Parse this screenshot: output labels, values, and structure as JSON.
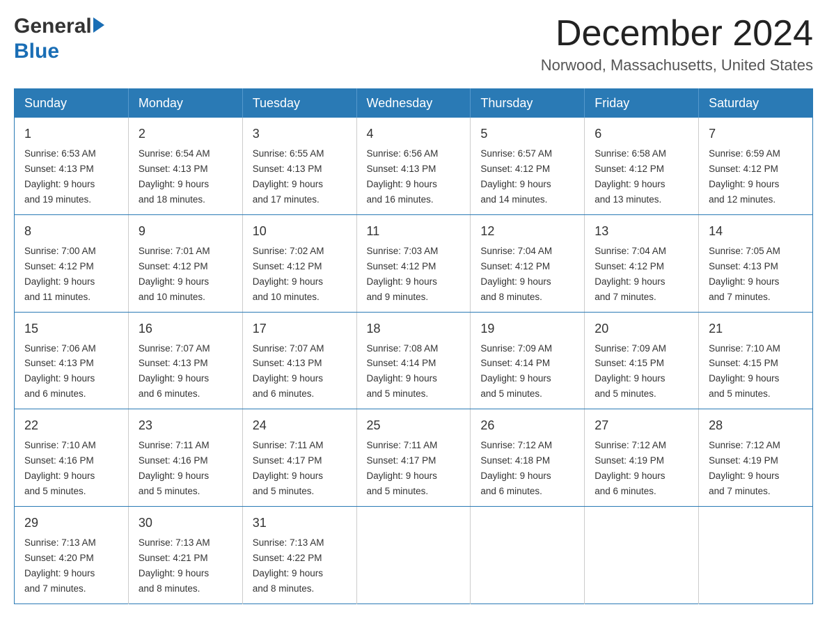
{
  "header": {
    "logo_general": "General",
    "logo_blue": "Blue",
    "month_title": "December 2024",
    "location": "Norwood, Massachusetts, United States"
  },
  "days_of_week": [
    "Sunday",
    "Monday",
    "Tuesday",
    "Wednesday",
    "Thursday",
    "Friday",
    "Saturday"
  ],
  "weeks": [
    [
      {
        "day": "1",
        "sunrise": "6:53 AM",
        "sunset": "4:13 PM",
        "daylight": "9 hours and 19 minutes."
      },
      {
        "day": "2",
        "sunrise": "6:54 AM",
        "sunset": "4:13 PM",
        "daylight": "9 hours and 18 minutes."
      },
      {
        "day": "3",
        "sunrise": "6:55 AM",
        "sunset": "4:13 PM",
        "daylight": "9 hours and 17 minutes."
      },
      {
        "day": "4",
        "sunrise": "6:56 AM",
        "sunset": "4:13 PM",
        "daylight": "9 hours and 16 minutes."
      },
      {
        "day": "5",
        "sunrise": "6:57 AM",
        "sunset": "4:12 PM",
        "daylight": "9 hours and 14 minutes."
      },
      {
        "day": "6",
        "sunrise": "6:58 AM",
        "sunset": "4:12 PM",
        "daylight": "9 hours and 13 minutes."
      },
      {
        "day": "7",
        "sunrise": "6:59 AM",
        "sunset": "4:12 PM",
        "daylight": "9 hours and 12 minutes."
      }
    ],
    [
      {
        "day": "8",
        "sunrise": "7:00 AM",
        "sunset": "4:12 PM",
        "daylight": "9 hours and 11 minutes."
      },
      {
        "day": "9",
        "sunrise": "7:01 AM",
        "sunset": "4:12 PM",
        "daylight": "9 hours and 10 minutes."
      },
      {
        "day": "10",
        "sunrise": "7:02 AM",
        "sunset": "4:12 PM",
        "daylight": "9 hours and 10 minutes."
      },
      {
        "day": "11",
        "sunrise": "7:03 AM",
        "sunset": "4:12 PM",
        "daylight": "9 hours and 9 minutes."
      },
      {
        "day": "12",
        "sunrise": "7:04 AM",
        "sunset": "4:12 PM",
        "daylight": "9 hours and 8 minutes."
      },
      {
        "day": "13",
        "sunrise": "7:04 AM",
        "sunset": "4:12 PM",
        "daylight": "9 hours and 7 minutes."
      },
      {
        "day": "14",
        "sunrise": "7:05 AM",
        "sunset": "4:13 PM",
        "daylight": "9 hours and 7 minutes."
      }
    ],
    [
      {
        "day": "15",
        "sunrise": "7:06 AM",
        "sunset": "4:13 PM",
        "daylight": "9 hours and 6 minutes."
      },
      {
        "day": "16",
        "sunrise": "7:07 AM",
        "sunset": "4:13 PM",
        "daylight": "9 hours and 6 minutes."
      },
      {
        "day": "17",
        "sunrise": "7:07 AM",
        "sunset": "4:13 PM",
        "daylight": "9 hours and 6 minutes."
      },
      {
        "day": "18",
        "sunrise": "7:08 AM",
        "sunset": "4:14 PM",
        "daylight": "9 hours and 5 minutes."
      },
      {
        "day": "19",
        "sunrise": "7:09 AM",
        "sunset": "4:14 PM",
        "daylight": "9 hours and 5 minutes."
      },
      {
        "day": "20",
        "sunrise": "7:09 AM",
        "sunset": "4:15 PM",
        "daylight": "9 hours and 5 minutes."
      },
      {
        "day": "21",
        "sunrise": "7:10 AM",
        "sunset": "4:15 PM",
        "daylight": "9 hours and 5 minutes."
      }
    ],
    [
      {
        "day": "22",
        "sunrise": "7:10 AM",
        "sunset": "4:16 PM",
        "daylight": "9 hours and 5 minutes."
      },
      {
        "day": "23",
        "sunrise": "7:11 AM",
        "sunset": "4:16 PM",
        "daylight": "9 hours and 5 minutes."
      },
      {
        "day": "24",
        "sunrise": "7:11 AM",
        "sunset": "4:17 PM",
        "daylight": "9 hours and 5 minutes."
      },
      {
        "day": "25",
        "sunrise": "7:11 AM",
        "sunset": "4:17 PM",
        "daylight": "9 hours and 5 minutes."
      },
      {
        "day": "26",
        "sunrise": "7:12 AM",
        "sunset": "4:18 PM",
        "daylight": "9 hours and 6 minutes."
      },
      {
        "day": "27",
        "sunrise": "7:12 AM",
        "sunset": "4:19 PM",
        "daylight": "9 hours and 6 minutes."
      },
      {
        "day": "28",
        "sunrise": "7:12 AM",
        "sunset": "4:19 PM",
        "daylight": "9 hours and 7 minutes."
      }
    ],
    [
      {
        "day": "29",
        "sunrise": "7:13 AM",
        "sunset": "4:20 PM",
        "daylight": "9 hours and 7 minutes."
      },
      {
        "day": "30",
        "sunrise": "7:13 AM",
        "sunset": "4:21 PM",
        "daylight": "9 hours and 8 minutes."
      },
      {
        "day": "31",
        "sunrise": "7:13 AM",
        "sunset": "4:22 PM",
        "daylight": "9 hours and 8 minutes."
      },
      null,
      null,
      null,
      null
    ]
  ],
  "labels": {
    "sunrise_prefix": "Sunrise: ",
    "sunset_prefix": "Sunset: ",
    "daylight_prefix": "Daylight: 9 hours"
  }
}
